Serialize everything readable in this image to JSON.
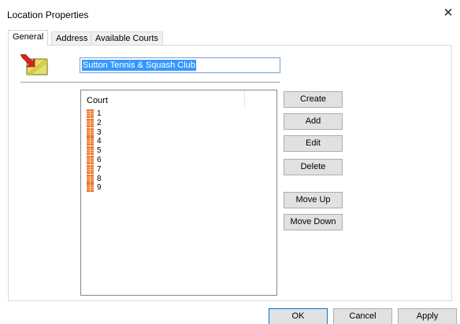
{
  "window": {
    "title": "Location Properties",
    "close_symbol": "✕"
  },
  "tabs": [
    {
      "label": "General",
      "active": true
    },
    {
      "label": "Address",
      "active": false
    },
    {
      "label": "Available Courts",
      "active": false
    }
  ],
  "general": {
    "location_icon": "location-edit-icon",
    "name_value": "Sutton Tennis & Squash Club",
    "courts_list": {
      "header": "Court",
      "item_icon": "court-icon",
      "items": [
        "1",
        "2",
        "3",
        "4",
        "5",
        "6",
        "7",
        "8",
        "9"
      ]
    },
    "side_buttons": {
      "create": "Create",
      "add": "Add",
      "edit": "Edit",
      "delete": "Delete",
      "move_up": "Move Up",
      "move_down": "Move Down"
    }
  },
  "footer": {
    "ok": "OK",
    "cancel": "Cancel",
    "apply": "Apply"
  },
  "colors": {
    "selection": "#3399ff",
    "court_icon": "#e8742a",
    "button_face": "#e1e1e1",
    "default_border": "#0078d7"
  }
}
